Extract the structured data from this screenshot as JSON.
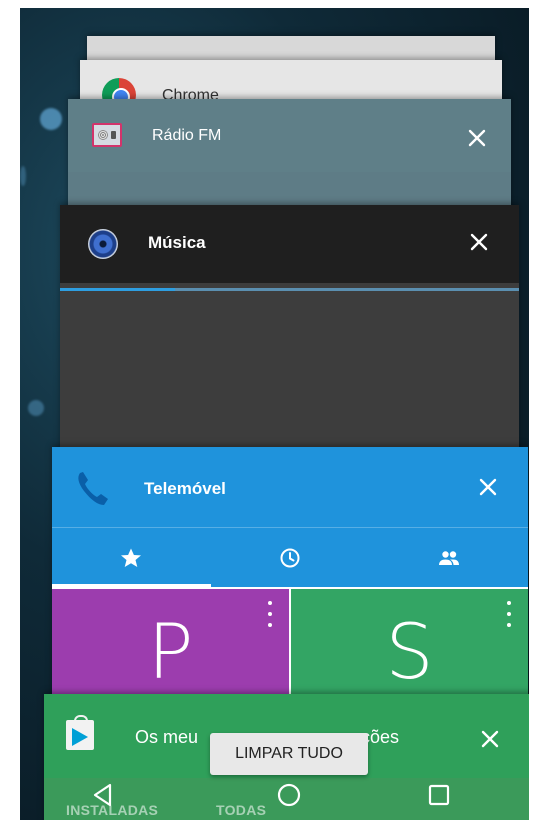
{
  "recents": {
    "cards": [
      {
        "id": "blank",
        "title": ""
      },
      {
        "id": "chrome",
        "title": "Chrome",
        "icon": "chrome-icon"
      },
      {
        "id": "radio",
        "title": "Rádio FM",
        "icon": "radio-icon",
        "color": "#5f7f88"
      },
      {
        "id": "musica",
        "title": "Música",
        "icon": "music-icon",
        "color": "#1f1f1f",
        "progress": 0.25
      },
      {
        "id": "telemovel",
        "title": "Telemóvel",
        "icon": "phone-icon",
        "color": "#1f93dc"
      },
      {
        "id": "store",
        "title": "Os meus jogos e aplicações",
        "title_visible_left": "Os meu",
        "title_visible_right": "ações",
        "icon": "play-store-icon",
        "color": "#2fa05a"
      }
    ],
    "close_icon": "close-icon"
  },
  "telemovel": {
    "tabs": [
      {
        "name": "favorites",
        "icon": "star-icon",
        "active": true
      },
      {
        "name": "recent",
        "icon": "clock-icon",
        "active": false
      },
      {
        "name": "contacts",
        "icon": "people-icon",
        "active": false
      }
    ],
    "tiles": [
      {
        "letter": "P",
        "color": "#9c3dae"
      },
      {
        "letter": "S",
        "color": "#33a564"
      }
    ]
  },
  "store": {
    "tabs": [
      "INSTALADAS",
      "TODAS"
    ]
  },
  "limpar_tudo": "LIMPAR TUDO",
  "navbar": {
    "back": "back-icon",
    "home": "home-icon",
    "recents": "recents-icon"
  }
}
